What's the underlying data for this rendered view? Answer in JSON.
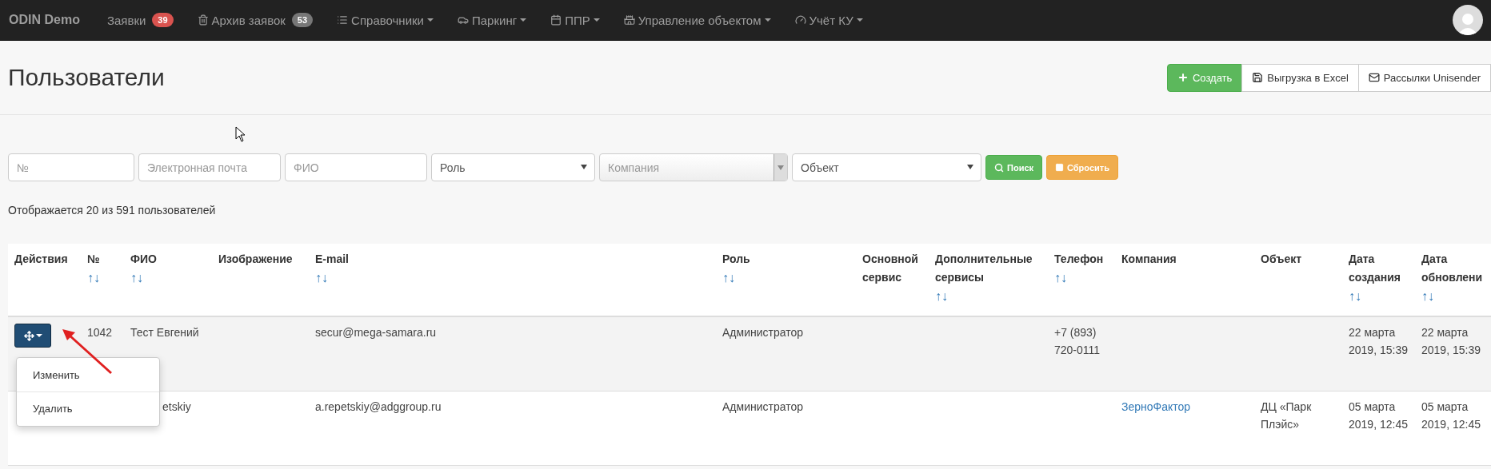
{
  "navbar": {
    "brand": "ODIN Demo",
    "items": [
      {
        "label": "Заявки",
        "has_menu": false,
        "badge": {
          "text": "39",
          "color": "#d9534f"
        }
      },
      {
        "label": "Архив заявок",
        "has_menu": false,
        "badge": {
          "text": "53",
          "color": "#777777"
        }
      },
      {
        "label": "Справочники",
        "has_menu": true
      },
      {
        "label": "Паркинг",
        "has_menu": true
      },
      {
        "label": "ППР",
        "has_menu": true
      },
      {
        "label": "Управление объектом",
        "has_menu": true
      },
      {
        "label": "Учёт КУ",
        "has_menu": true
      }
    ]
  },
  "page": {
    "title": "Пользователи",
    "actions": [
      {
        "kind": "create",
        "label": "Создать"
      },
      {
        "kind": "export",
        "label": "Выгрузка в Excel"
      },
      {
        "kind": "mail",
        "label": "Рассылки Unisender"
      }
    ]
  },
  "filters": [
    {
      "kind": "text",
      "placeholder": "№"
    },
    {
      "kind": "text",
      "placeholder": "Электронная почта"
    },
    {
      "kind": "text",
      "placeholder": "ФИО"
    },
    {
      "kind": "select",
      "placeholder": "Роль"
    },
    {
      "kind": "combo",
      "placeholder": "Компания"
    },
    {
      "kind": "select",
      "placeholder": "Объект"
    }
  ],
  "filter_buttons": [
    {
      "kind": "search",
      "label": "Поиск"
    },
    {
      "kind": "reset",
      "label": "Сбросить"
    }
  ],
  "summary": "Отображается 20 из 591 пользователей",
  "table": {
    "columns": [
      {
        "label": "Действия",
        "sortable": false
      },
      {
        "label": "№",
        "sortable": true
      },
      {
        "label": "ФИО",
        "sortable": true
      },
      {
        "label": "Изображение",
        "sortable": false
      },
      {
        "label": "E-mail",
        "sortable": true
      },
      {
        "label": "Роль",
        "sortable": true
      },
      {
        "label": "Основной сервис",
        "sortable": false
      },
      {
        "label": "Дополнительные сервисы",
        "sortable": true
      },
      {
        "label": "Телефон",
        "sortable": true
      },
      {
        "label": "Компания",
        "sortable": false
      },
      {
        "label": "Объект",
        "sortable": false
      },
      {
        "label": "Дата создания",
        "sortable": true
      },
      {
        "label": "Дата обновлени",
        "sortable": true
      }
    ],
    "sort_mark": "↑↓",
    "rows": [
      {
        "highlighted": true,
        "menu_open": true,
        "id": "1042",
        "fio": "Тест Евгений",
        "fio_covered": false,
        "email": "secur@mega-samara.ru",
        "role": "Администратор",
        "phone": "+7 (893) 720-0111",
        "created": "22 марта 2019, 15:39",
        "updated": "22 марта 2019, 15:39"
      },
      {
        "highlighted": false,
        "menu_open": false,
        "fio": "etskiy",
        "fio_covered": true,
        "email": "a.repetskiy@adggroup.ru",
        "role": "Администратор",
        "company": "ЗерноФактор",
        "object": "ДЦ «Парк Плэйс»",
        "created": "05 марта 2019, 12:45",
        "updated": "05 марта 2019, 12:45"
      }
    ],
    "row_menu": [
      "Изменить",
      "Удалить"
    ]
  }
}
